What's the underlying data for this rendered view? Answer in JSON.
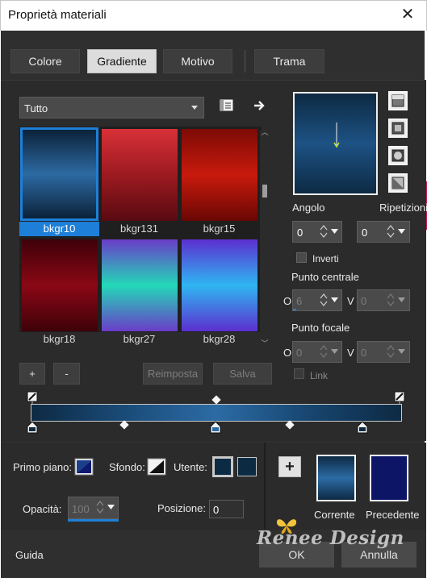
{
  "window": {
    "title": "Proprietà materiali",
    "close_glyph": "✕"
  },
  "tabs": [
    {
      "label": "Colore",
      "active": false
    },
    {
      "label": "Gradiente",
      "active": true
    },
    {
      "label": "Motivo",
      "active": false
    },
    {
      "label": "Trama",
      "active": false
    }
  ],
  "library": {
    "category": "Tutto",
    "items": [
      {
        "label": "bkgr10",
        "selected": true,
        "gradient": [
          "#0b2239",
          "#2d6aa2",
          "#0b2239"
        ]
      },
      {
        "label": "bkgr131",
        "selected": false,
        "gradient": [
          "#d93038",
          "#9c1a20",
          "#5a0a12"
        ]
      },
      {
        "label": "bkgr15",
        "selected": false,
        "gradient": [
          "#7d0a06",
          "#c81a0c",
          "#6a0704"
        ]
      },
      {
        "label": "bkgr18",
        "selected": false,
        "gradient": [
          "#3e0109",
          "#8a0815",
          "#3e0109"
        ]
      },
      {
        "label": "bkgr27",
        "selected": false,
        "gradient": [
          "#6a3cc8",
          "#23d8b8",
          "#6a3cc8"
        ]
      },
      {
        "label": "bkgr28",
        "selected": false,
        "gradient": [
          "#5c2fcf",
          "#2fb6f2",
          "#5c2fcf"
        ]
      }
    ]
  },
  "buttons": {
    "add": "+",
    "remove": "-",
    "reset": "Reimposta",
    "save": "Salva"
  },
  "settings": {
    "angle_label": "Angolo",
    "angle_value": "0",
    "repeat_label": "Ripetizioni",
    "repeat_value": "0",
    "invert_label": "Inverti",
    "center_label": "Punto centrale",
    "center_o": "O",
    "center_o_value": "6",
    "center_v": "V",
    "center_v_value": "0",
    "focal_label": "Punto focale",
    "focal_o": "O",
    "focal_o_value": "0",
    "focal_v": "V",
    "focal_v_value": "0",
    "link_label": "Link"
  },
  "colors": {
    "foreground_label": "Primo piano:",
    "background_label": "Sfondo:",
    "user_label": "Utente:",
    "opacity_label": "Opacità:",
    "opacity_value": "100",
    "position_label": "Posizione:",
    "position_value": "0",
    "current_label": "Corrente",
    "previous_label": "Precedente",
    "add_glyph": "+"
  },
  "footer": {
    "help": "Guida",
    "ok": "OK",
    "cancel": "Annulla",
    "watermark": "Renee Design"
  }
}
